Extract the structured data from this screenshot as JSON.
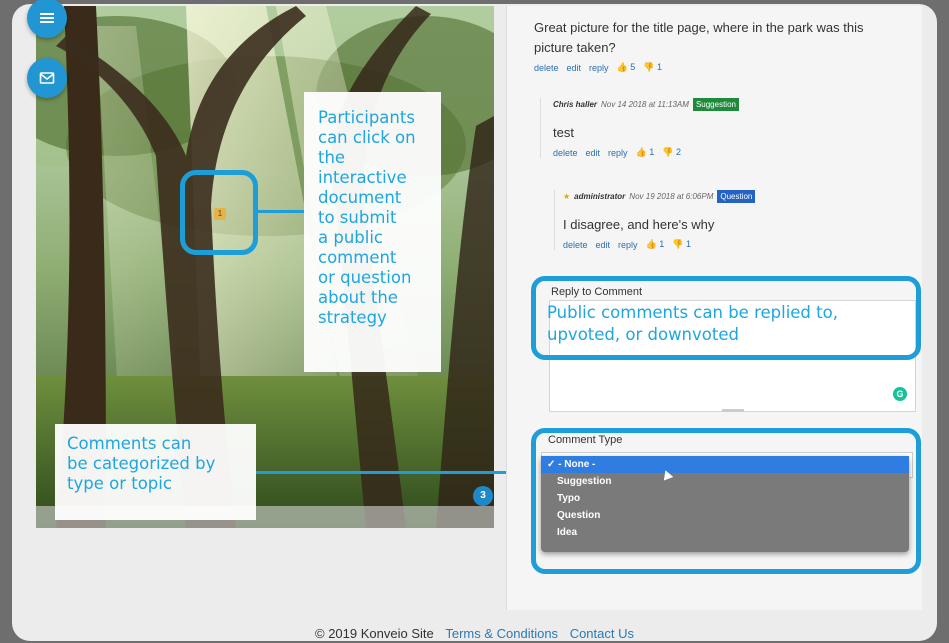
{
  "nav": {
    "menu_icon": "hamburger-icon",
    "mail_icon": "mail-icon"
  },
  "document": {
    "pin_label": "1",
    "page_number": "3"
  },
  "callouts": {
    "interactive_lines": [
      "Participants",
      "can click on",
      "the interactive",
      "document",
      "to submit",
      "a public",
      "comment",
      "or question",
      "about the",
      "strategy"
    ],
    "categorized_lines": [
      "Comments can",
      "be categorized by",
      "type or topic"
    ],
    "reply_lines": [
      "Public comments can be replied to,",
      "upvoted, or downvoted"
    ]
  },
  "comments": {
    "top": {
      "text_line1": "Great picture for the title page, where in the park was this",
      "text_line2": "picture taken?",
      "delete": "delete",
      "edit": "edit",
      "reply": "reply",
      "upvotes": "5",
      "downvotes": "1"
    },
    "reply1": {
      "author": "Chris haller",
      "date": "Nov 14 2018 at 11:13AM",
      "badge": "Suggestion",
      "text": "test",
      "delete": "delete",
      "edit": "edit",
      "reply": "reply",
      "upvotes": "1",
      "downvotes": "2"
    },
    "reply2": {
      "author": "administrator",
      "date": "Nov 19 2018 at 6:06PM",
      "badge": "Question",
      "text": "I disagree, and here's why",
      "delete": "delete",
      "edit": "edit",
      "reply": "reply",
      "upvotes": "1",
      "downvotes": "1"
    }
  },
  "reply_form": {
    "label": "Reply to Comment",
    "comment_type_label": "Comment Type",
    "options": [
      "- None -",
      "Suggestion",
      "Typo",
      "Question",
      "Idea"
    ],
    "selected_check": "✓"
  },
  "footer": {
    "copyright": "© 2019 Konveio Site",
    "terms": "Terms & Conditions",
    "contact": "Contact Us"
  },
  "colors": {
    "accent": "#1d9ed9",
    "suggestion_badge": "#1f8a3c",
    "question_badge": "#2462c4"
  }
}
